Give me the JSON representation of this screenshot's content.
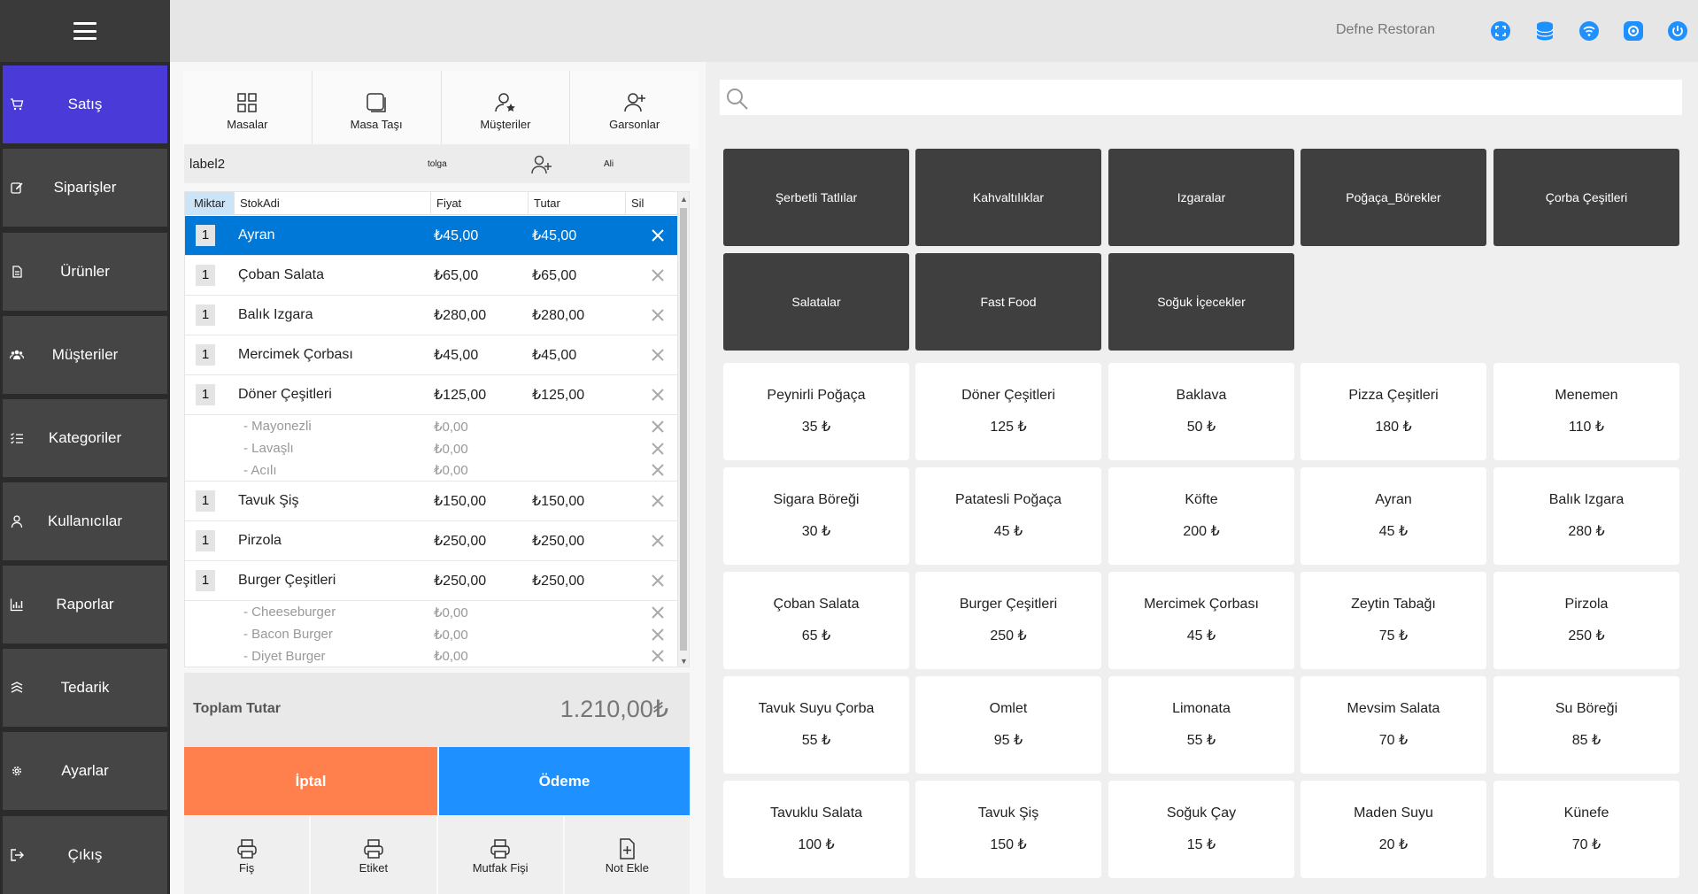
{
  "sidebar": {
    "items": [
      {
        "label": "Satış",
        "icon": "cart-icon"
      },
      {
        "label": "Siparişler",
        "icon": "edit-icon"
      },
      {
        "label": "Ürünler",
        "icon": "document-icon"
      },
      {
        "label": "Müşteriler",
        "icon": "users-icon"
      },
      {
        "label": "Kategoriler",
        "icon": "list-icon"
      },
      {
        "label": "Kullanıcılar",
        "icon": "user-icon"
      },
      {
        "label": "Raporlar",
        "icon": "chart-icon"
      },
      {
        "label": "Tedarik",
        "icon": "supply-icon"
      },
      {
        "label": "Ayarlar",
        "icon": "gear-icon"
      },
      {
        "label": "Çıkış",
        "icon": "logout-icon"
      }
    ]
  },
  "header": {
    "restaurant_name": "Defne Restoran",
    "icons": [
      "fullscreen-icon",
      "database-icon",
      "wifi-icon",
      "settings-icon",
      "power-icon"
    ]
  },
  "toolbar": {
    "tables": "Masalar",
    "move_table": "Masa Taşı",
    "customers": "Müşteriler",
    "waiters": "Garsonlar"
  },
  "customer_row": {
    "label": "label2",
    "waiter": "tolga",
    "user": "Ali"
  },
  "grid": {
    "headers": [
      "Miktar",
      "StokAdi",
      "Fiyat",
      "Tutar",
      "Sil"
    ],
    "rows": [
      {
        "qty": "1",
        "name": "Ayran",
        "price": "₺45,00",
        "total": "₺45,00",
        "subs": []
      },
      {
        "qty": "1",
        "name": "Çoban Salata",
        "price": "₺65,00",
        "total": "₺65,00",
        "subs": []
      },
      {
        "qty": "1",
        "name": "Balık Izgara",
        "price": "₺280,00",
        "total": "₺280,00",
        "subs": []
      },
      {
        "qty": "1",
        "name": "Mercimek Çorbası",
        "price": "₺45,00",
        "total": "₺45,00",
        "subs": []
      },
      {
        "qty": "1",
        "name": "Döner Çeşitleri",
        "price": "₺125,00",
        "total": "₺125,00",
        "subs": [
          {
            "name": "- Mayonezli",
            "price": "₺0,00"
          },
          {
            "name": "- Lavaşlı",
            "price": "₺0,00"
          },
          {
            "name": "- Acılı",
            "price": "₺0,00"
          }
        ]
      },
      {
        "qty": "1",
        "name": "Tavuk Şiş",
        "price": "₺150,00",
        "total": "₺150,00",
        "subs": []
      },
      {
        "qty": "1",
        "name": "Pirzola",
        "price": "₺250,00",
        "total": "₺250,00",
        "subs": []
      },
      {
        "qty": "1",
        "name": "Burger Çeşitleri",
        "price": "₺250,00",
        "total": "₺250,00",
        "subs": [
          {
            "name": "- Cheeseburger",
            "price": "₺0,00"
          },
          {
            "name": "- Bacon Burger",
            "price": "₺0,00"
          },
          {
            "name": "- Diyet Burger",
            "price": "₺0,00"
          }
        ]
      }
    ]
  },
  "summary": {
    "label": "Toplam Tutar",
    "value": "1.210,00₺"
  },
  "actions": {
    "cancel": "İptal",
    "pay": "Ödeme",
    "receipt": "Fiş",
    "label": "Etiket",
    "kitchen": "Mutfak Fişi",
    "note": "Not Ekle"
  },
  "search": {
    "placeholder": ""
  },
  "categories": [
    "Şerbetli Tatlılar",
    "Kahvaltılıklar",
    "Izgaralar",
    "Poğaça_Börekler",
    "Çorba Çeşitleri",
    "Salatalar",
    "Fast Food",
    "Soğuk İçecekler"
  ],
  "products": [
    {
      "name": "Peynirli Poğaça",
      "price": "35 ₺"
    },
    {
      "name": "Döner Çeşitleri",
      "price": "125 ₺"
    },
    {
      "name": "Baklava",
      "price": "50 ₺"
    },
    {
      "name": "Pizza Çeşitleri",
      "price": "180 ₺"
    },
    {
      "name": "Menemen",
      "price": "110 ₺"
    },
    {
      "name": "Sigara Böreği",
      "price": "30 ₺"
    },
    {
      "name": "Patatesli Poğaça",
      "price": "45 ₺"
    },
    {
      "name": "Köfte",
      "price": "200 ₺"
    },
    {
      "name": "Ayran",
      "price": "45 ₺"
    },
    {
      "name": "Balık Izgara",
      "price": "280 ₺"
    },
    {
      "name": "Çoban Salata",
      "price": "65 ₺"
    },
    {
      "name": "Burger Çeşitleri",
      "price": "250 ₺"
    },
    {
      "name": "Mercimek Çorbası",
      "price": "45 ₺"
    },
    {
      "name": "Zeytin Tabağı",
      "price": "75 ₺"
    },
    {
      "name": "Pirzola",
      "price": "250 ₺"
    },
    {
      "name": "Tavuk Suyu Çorba",
      "price": "55 ₺"
    },
    {
      "name": "Omlet",
      "price": "95 ₺"
    },
    {
      "name": "Limonata",
      "price": "55 ₺"
    },
    {
      "name": "Mevsim Salata",
      "price": "70 ₺"
    },
    {
      "name": "Su Böreği",
      "price": "85 ₺"
    },
    {
      "name": "Tavuklu Salata",
      "price": "100 ₺"
    },
    {
      "name": "Tavuk Şiş",
      "price": "150 ₺"
    },
    {
      "name": "Soğuk Çay",
      "price": "15 ₺"
    },
    {
      "name": "Maden Suyu",
      "price": "20 ₺"
    },
    {
      "name": "Künefe",
      "price": "70 ₺"
    }
  ],
  "colors": {
    "sidebar_bg": "#2b2b2b",
    "sidebar_item": "#454545",
    "sidebar_active": "#4a3bd8",
    "selected_row": "#0078d7",
    "cancel": "#ff7f4d",
    "pay": "#1e90ff",
    "category_bg": "#3f3f3f",
    "top_icon": "#1e90ff"
  }
}
